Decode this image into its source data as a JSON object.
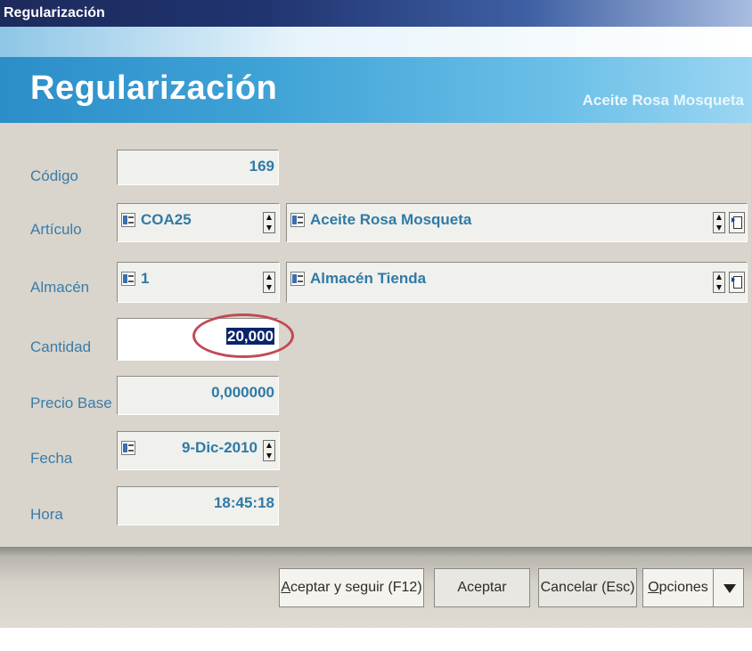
{
  "window": {
    "title": "Regularización"
  },
  "header": {
    "title": "Regularización",
    "subtitle": "Aceite Rosa Mosqueta"
  },
  "fields": {
    "codigo": {
      "label": "Código",
      "value": "169"
    },
    "articulo": {
      "label": "Artículo",
      "code": "COA25",
      "name": "Aceite Rosa Mosqueta"
    },
    "almacen": {
      "label": "Almacén",
      "code": "1",
      "name": "Almacén Tienda"
    },
    "cantidad": {
      "label": "Cantidad",
      "value": "20,000"
    },
    "precio": {
      "label": "Precio Base",
      "value": "0,000000"
    },
    "fecha": {
      "label": "Fecha",
      "value": "9-Dic-2010"
    },
    "hora": {
      "label": "Hora",
      "value": "18:45:18"
    }
  },
  "buttons": {
    "aceptar_seguir": {
      "first": "A",
      "rest": "ceptar y seguir (F12)"
    },
    "aceptar": "Aceptar",
    "cancelar": "Cancelar (Esc)",
    "opciones": {
      "first": "O",
      "rest": "pciones"
    }
  },
  "icons": [
    "picker-icon",
    "spinner-icon",
    "goto-icon",
    "dropdown-arrow-icon"
  ],
  "colors": {
    "accent": "#2f7aa6",
    "header": "#3fa2d6",
    "highlight": "#c24a55"
  }
}
